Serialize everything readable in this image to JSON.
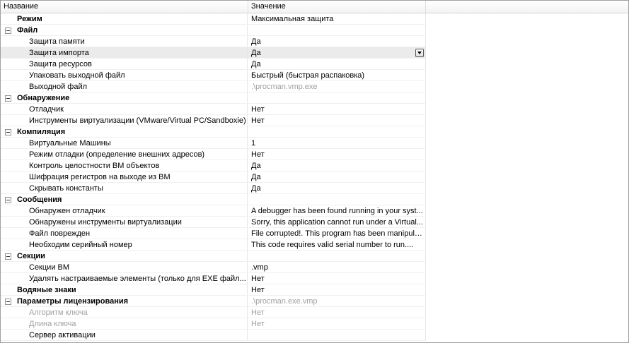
{
  "header": {
    "name": "Название",
    "value": "Значение"
  },
  "rows": [
    {
      "type": "root",
      "name": "Режим",
      "value": "Максимальная защита",
      "disabled": false
    },
    {
      "type": "cat",
      "name": "Файл",
      "value": "",
      "disabled": false
    },
    {
      "type": "child",
      "name": "Защита памяти",
      "value": "Да",
      "disabled": false
    },
    {
      "type": "child",
      "name": "Защита импорта",
      "value": "Да",
      "disabled": false,
      "selected": true,
      "dropdown": true
    },
    {
      "type": "child",
      "name": "Защита ресурсов",
      "value": "Да",
      "disabled": false
    },
    {
      "type": "child",
      "name": "Упаковать выходной файл",
      "value": "Быстрый (быстрая распаковка)",
      "disabled": false
    },
    {
      "type": "child",
      "name": "Выходной файл",
      "value": ".\\procman.vmp.exe",
      "disabled": false,
      "valueDisabled": true
    },
    {
      "type": "cat",
      "name": "Обнаружение",
      "value": "",
      "disabled": false
    },
    {
      "type": "child",
      "name": "Отладчик",
      "value": "Нет",
      "disabled": false
    },
    {
      "type": "child",
      "name": "Инструменты виртуализации (VMware/Virtual PC/Sandboxie)",
      "value": "Нет",
      "disabled": false
    },
    {
      "type": "cat",
      "name": "Компиляция",
      "value": "",
      "disabled": false
    },
    {
      "type": "child",
      "name": "Виртуальные Машины",
      "value": "1",
      "disabled": false
    },
    {
      "type": "child",
      "name": "Режим отладки (определение внешних адресов)",
      "value": "Нет",
      "disabled": false
    },
    {
      "type": "child",
      "name": "Контроль целостности ВМ объектов",
      "value": "Да",
      "disabled": false
    },
    {
      "type": "child",
      "name": "Шифрация регистров на выходе из ВМ",
      "value": "Да",
      "disabled": false
    },
    {
      "type": "child",
      "name": "Скрывать константы",
      "value": "Да",
      "disabled": false
    },
    {
      "type": "cat",
      "name": "Сообщения",
      "value": "",
      "disabled": false
    },
    {
      "type": "child",
      "name": "Обнаружен отладчик",
      "value": "A debugger has been found running in your syst...",
      "disabled": false
    },
    {
      "type": "child",
      "name": "Обнаружены инструменты виртуализации",
      "value": "Sorry, this application cannot run under a Virtual...",
      "disabled": false
    },
    {
      "type": "child",
      "name": "Файл поврежден",
      "value": "File corrupted!. This program has been manipula...",
      "disabled": false
    },
    {
      "type": "child",
      "name": "Необходим серийный номер",
      "value": "This code requires valid serial number to run....",
      "disabled": false
    },
    {
      "type": "cat",
      "name": "Секции",
      "value": "",
      "disabled": false
    },
    {
      "type": "child",
      "name": "Секции ВМ",
      "value": ".vmp",
      "disabled": false
    },
    {
      "type": "child",
      "name": "Удалять настраиваемые элементы (только для EXE файл...",
      "value": "Нет",
      "disabled": false
    },
    {
      "type": "root",
      "name": "Водяные знаки",
      "value": "Нет",
      "disabled": false
    },
    {
      "type": "cat",
      "name": "Параметры лицензирования",
      "value": ".\\procman.exe.vmp",
      "disabled": false,
      "valueDisabled": true
    },
    {
      "type": "child",
      "name": "Алгоритм ключа",
      "value": "Нет",
      "disabled": true
    },
    {
      "type": "child",
      "name": "Длина ключа",
      "value": "Нет",
      "disabled": true
    },
    {
      "type": "child",
      "name": "Сервер активации",
      "value": "",
      "disabled": false
    }
  ],
  "icons": {
    "expanded": "tree-collapse-icon",
    "dropdown": "dropdown-arrow-icon"
  }
}
